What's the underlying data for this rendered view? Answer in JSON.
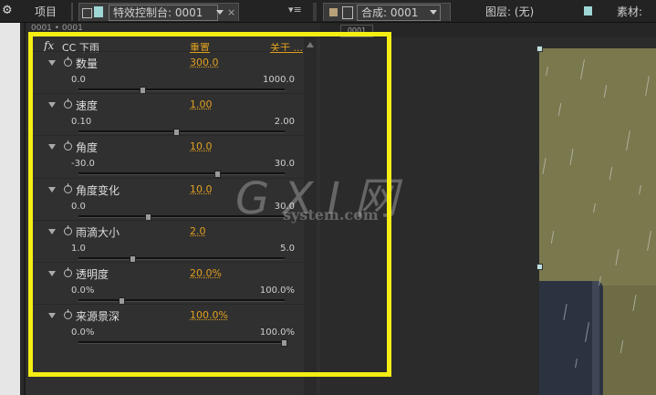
{
  "tabs": {
    "project": "项目",
    "effect_controls": "特效控制台: 0001",
    "composition": "合成: 0001",
    "layer": "图层: (无)",
    "footage": "素材: "
  },
  "panel": {
    "header_label": "0001 • 0001",
    "effect_name": "CC 下雨",
    "reset_label": "重置",
    "about_label": "关于 ...",
    "fx_label": "fx"
  },
  "comp": {
    "frame_label": "0001"
  },
  "params": [
    {
      "name": "数量",
      "value": "300.0",
      "min": "0.0",
      "max": "1000.0",
      "fraction": 0.3
    },
    {
      "name": "速度",
      "value": "1.00",
      "min": "0.10",
      "max": "2.00",
      "fraction": 0.47
    },
    {
      "name": "角度",
      "value": "10.0",
      "min": "-30.0",
      "max": "30.0",
      "fraction": 0.67
    },
    {
      "name": "角度变化",
      "value": "10.0",
      "min": "0.0",
      "max": "30.0",
      "fraction": 0.33
    },
    {
      "name": "雨滴大小",
      "value": "2.0",
      "min": "1.0",
      "max": "5.0",
      "fraction": 0.25
    },
    {
      "name": "透明度",
      "value": "20.0%",
      "min": "0.0%",
      "max": "100.0%",
      "fraction": 0.2
    },
    {
      "name": "来源景深",
      "value": "100.0%",
      "min": "0.0%",
      "max": "100.0%",
      "fraction": 1.0
    }
  ],
  "watermark": {
    "main": "G X I 网",
    "sub": "system.com"
  }
}
